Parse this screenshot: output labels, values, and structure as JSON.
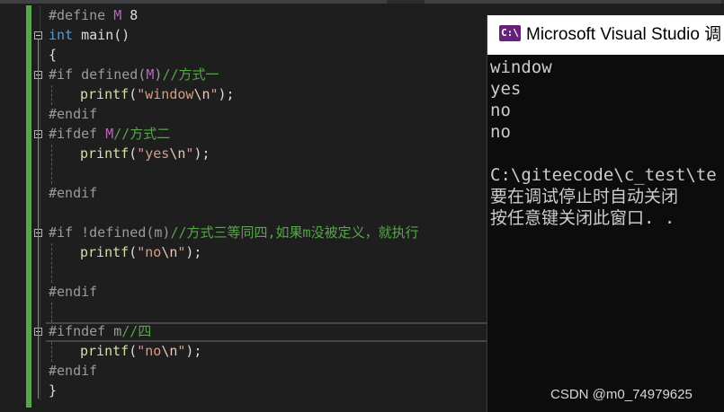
{
  "editor": {
    "lines": {
      "l1": {
        "pp": "#define ",
        "macro": "M",
        "rest": " 8"
      },
      "l2": {
        "kw": "int",
        "rest": " main()"
      },
      "l3": {
        "rest": "{"
      },
      "l4": {
        "pp": "#if defined(",
        "macro": "M",
        "pp2": ")",
        "cm": "//方式一"
      },
      "l5": {
        "fn": "printf",
        "p1": "(",
        "str": "\"window",
        "esc": "\\n",
        "str2": "\"",
        "p2": ");"
      },
      "l6": {
        "pp": "#endif"
      },
      "l7": {
        "pp": "#ifdef ",
        "macro": "M",
        "cm": "//方式二"
      },
      "l8": {
        "fn": "printf",
        "p1": "(",
        "str": "\"yes",
        "esc": "\\n",
        "str2": "\"",
        "p2": ");"
      },
      "l10": {
        "pp": "#endif"
      },
      "l12": {
        "pp": "#if !defined(m)",
        "cm": "//方式三等同四,如果m没被定义，就执行"
      },
      "l13": {
        "fn": "printf",
        "p1": "(",
        "str": "\"no",
        "esc": "\\n",
        "str2": "\"",
        "p2": ");"
      },
      "l15": {
        "pp": "#endif"
      },
      "l17": {
        "pp": "#ifndef m",
        "cm": "//四"
      },
      "l18": {
        "fn": "printf",
        "p1": "(",
        "str": "\"no",
        "esc": "\\n",
        "str2": "\"",
        "p2": ");"
      },
      "l19": {
        "pp": "#endif"
      },
      "l20": {
        "rest": "}"
      }
    }
  },
  "console": {
    "title": "Microsoft Visual Studio 调",
    "icon_label": "C:\\",
    "output": [
      "window",
      "yes",
      "no",
      "no",
      "",
      "C:\\giteecode\\c_test\\te",
      "要在调试停止时自动关闭",
      "按任意键关闭此窗口. ."
    ]
  },
  "watermark": "CSDN @m0_74979625",
  "colors": {
    "background": "#1e1e1e",
    "preprocessor": "#9b9b9b",
    "keyword": "#569cd6",
    "macro": "#bd63c5",
    "comment": "#57a64a",
    "string": "#d69d85",
    "function": "#dcdcaa",
    "console_bg": "#0c0c0c",
    "vs_purple": "#68217a"
  },
  "icons": [
    "collapse-icon",
    "visual-studio-icon"
  ]
}
